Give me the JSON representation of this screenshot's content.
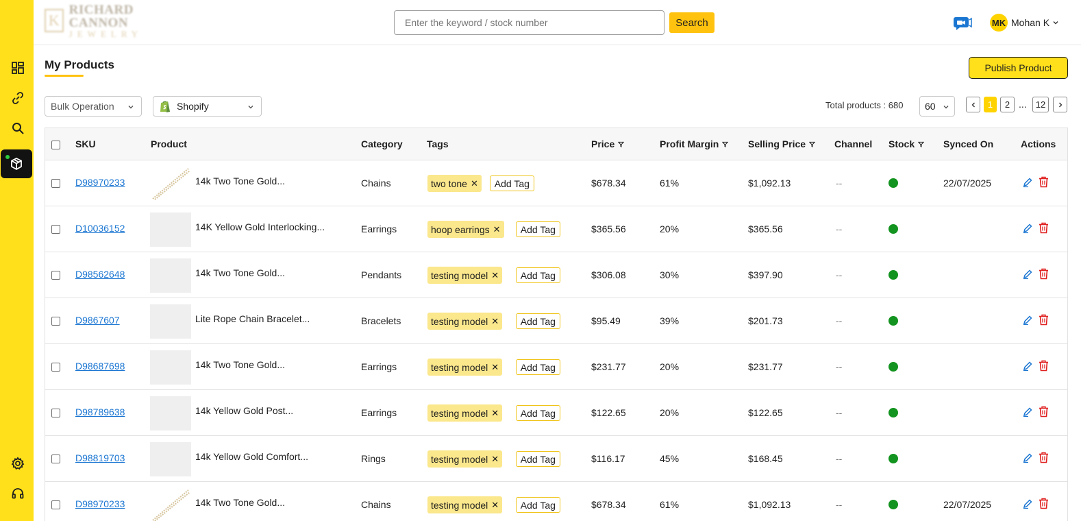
{
  "brand": {
    "line1": "RICHARD CANNON",
    "line2": "JEWELRY",
    "mark": "K"
  },
  "search": {
    "placeholder": "Enter the keyword / stock number",
    "button_label": "Search"
  },
  "user": {
    "initials": "MK",
    "name": "Mohan K"
  },
  "sidebar": {
    "items": [
      {
        "icon": "dashboard-icon"
      },
      {
        "icon": "link-icon"
      },
      {
        "icon": "search-icon"
      },
      {
        "icon": "box-icon",
        "active": true
      },
      {
        "icon": "gear-icon"
      },
      {
        "icon": "headset-icon"
      }
    ]
  },
  "page": {
    "title": "My Products",
    "publish_label": "Publish Product"
  },
  "toolbar": {
    "bulk_label": "Bulk Operation",
    "channel_label": "Shopify",
    "total_text": "Total products : 680",
    "page_size": "60",
    "pages": [
      "1",
      "2",
      "12"
    ],
    "ellipsis": "...",
    "current_page": "1"
  },
  "table": {
    "headers": {
      "sku": "SKU",
      "product": "Product",
      "category": "Category",
      "tags": "Tags",
      "price": "Price",
      "profit_margin": "Profit Margin",
      "selling_price": "Selling Price",
      "channel": "Channel",
      "stock": "Stock",
      "synced_on": "Synced On",
      "actions": "Actions"
    },
    "add_tag_label": "Add Tag",
    "rows": [
      {
        "sku": "D98970233",
        "product": "14k Two Tone Gold...",
        "category": "Chains",
        "tag": "two tone",
        "price": "$678.34",
        "margin": "61%",
        "selling": "$1,092.13",
        "channel": "--",
        "synced": "22/07/2025",
        "thumb": "chain"
      },
      {
        "sku": "D10036152",
        "product": "14K Yellow Gold Interlocking...",
        "category": "Earrings",
        "tag": "hoop earrings",
        "price": "$365.56",
        "margin": "20%",
        "selling": "$365.56",
        "channel": "--",
        "synced": "",
        "thumb": "blank"
      },
      {
        "sku": "D98562648",
        "product": "14k Two Tone Gold...",
        "category": "Pendants",
        "tag": "testing model",
        "price": "$306.08",
        "margin": "30%",
        "selling": "$397.90",
        "channel": "--",
        "synced": "",
        "thumb": "blank"
      },
      {
        "sku": "D9867607",
        "product": "Lite Rope Chain Bracelet...",
        "category": "Bracelets",
        "tag": "testing model",
        "price": "$95.49",
        "margin": "39%",
        "selling": "$201.73",
        "channel": "--",
        "synced": "",
        "thumb": "blank"
      },
      {
        "sku": "D98687698",
        "product": "14k Two Tone Gold...",
        "category": "Earrings",
        "tag": "testing model",
        "price": "$231.77",
        "margin": "20%",
        "selling": "$231.77",
        "channel": "--",
        "synced": "",
        "thumb": "blank"
      },
      {
        "sku": "D98789638",
        "product": "14k Yellow Gold Post...",
        "category": "Earrings",
        "tag": "testing model",
        "price": "$122.65",
        "margin": "20%",
        "selling": "$122.65",
        "channel": "--",
        "synced": "",
        "thumb": "blank"
      },
      {
        "sku": "D98819703",
        "product": "14k Yellow Gold Comfort...",
        "category": "Rings",
        "tag": "testing model",
        "price": "$116.17",
        "margin": "45%",
        "selling": "$168.45",
        "channel": "--",
        "synced": "",
        "thumb": "blank"
      },
      {
        "sku": "D98970233",
        "product": "14k Two Tone Gold...",
        "category": "Chains",
        "tag": "testing model",
        "price": "$678.34",
        "margin": "61%",
        "selling": "$1,092.13",
        "channel": "--",
        "synced": "22/07/2025",
        "thumb": "chain"
      }
    ]
  },
  "colors": {
    "sidebar": "#ffe01b",
    "accent": "#ffc20e",
    "link": "#1b76d2",
    "stock_in": "#13931f",
    "delete": "#e02020",
    "tag_bg": "#fbe78c"
  }
}
